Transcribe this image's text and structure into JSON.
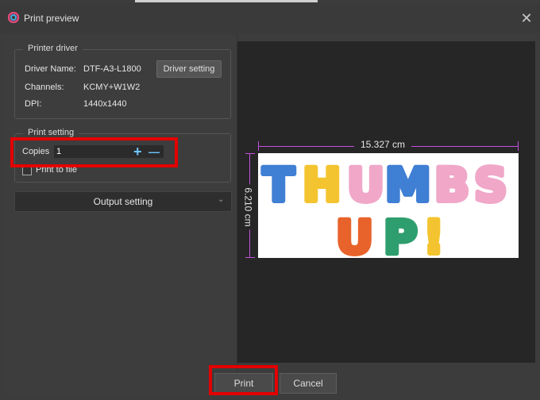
{
  "window": {
    "title": "Print preview",
    "close_glyph": "✕"
  },
  "printer_driver": {
    "legend": "Printer driver",
    "driver_name_label": "Driver Name:",
    "driver_name_value": "DTF-A3-L1800",
    "driver_setting_button": "Driver setting",
    "channels_label": "Channels:",
    "channels_value": "KCMY+W1W2",
    "dpi_label": "DPI:",
    "dpi_value": "1440x1440"
  },
  "print_setting": {
    "legend": "Print setting",
    "copies_label": "Copies",
    "copies_value": "1",
    "plus_glyph": "+",
    "minus_glyph": "—",
    "print_to_file_label": "Print to file",
    "print_to_file_checked": false
  },
  "output_setting": {
    "label": "Output setting",
    "chevron": "⌄"
  },
  "preview": {
    "width_label": "15.327 cm",
    "height_label": "6.210 cm",
    "artwork_line1": [
      "T",
      "H",
      "U",
      "M",
      "B",
      "S"
    ],
    "artwork_line1_colors": [
      "#3f7fd4",
      "#f4c430",
      "#f0a7c8",
      "#3f7fd4",
      "#f0a7c8",
      "#f0a7c8"
    ],
    "artwork_line2": [
      "U",
      "P",
      "!"
    ],
    "artwork_line2_colors": [
      "#e8632b",
      "#2f9e6e",
      "#f4c430"
    ]
  },
  "footer": {
    "print_button": "Print",
    "cancel_button": "Cancel"
  },
  "colors": {
    "highlight": "#e30000",
    "dimension": "#c34ee0",
    "accent": "#6ec6ff"
  }
}
